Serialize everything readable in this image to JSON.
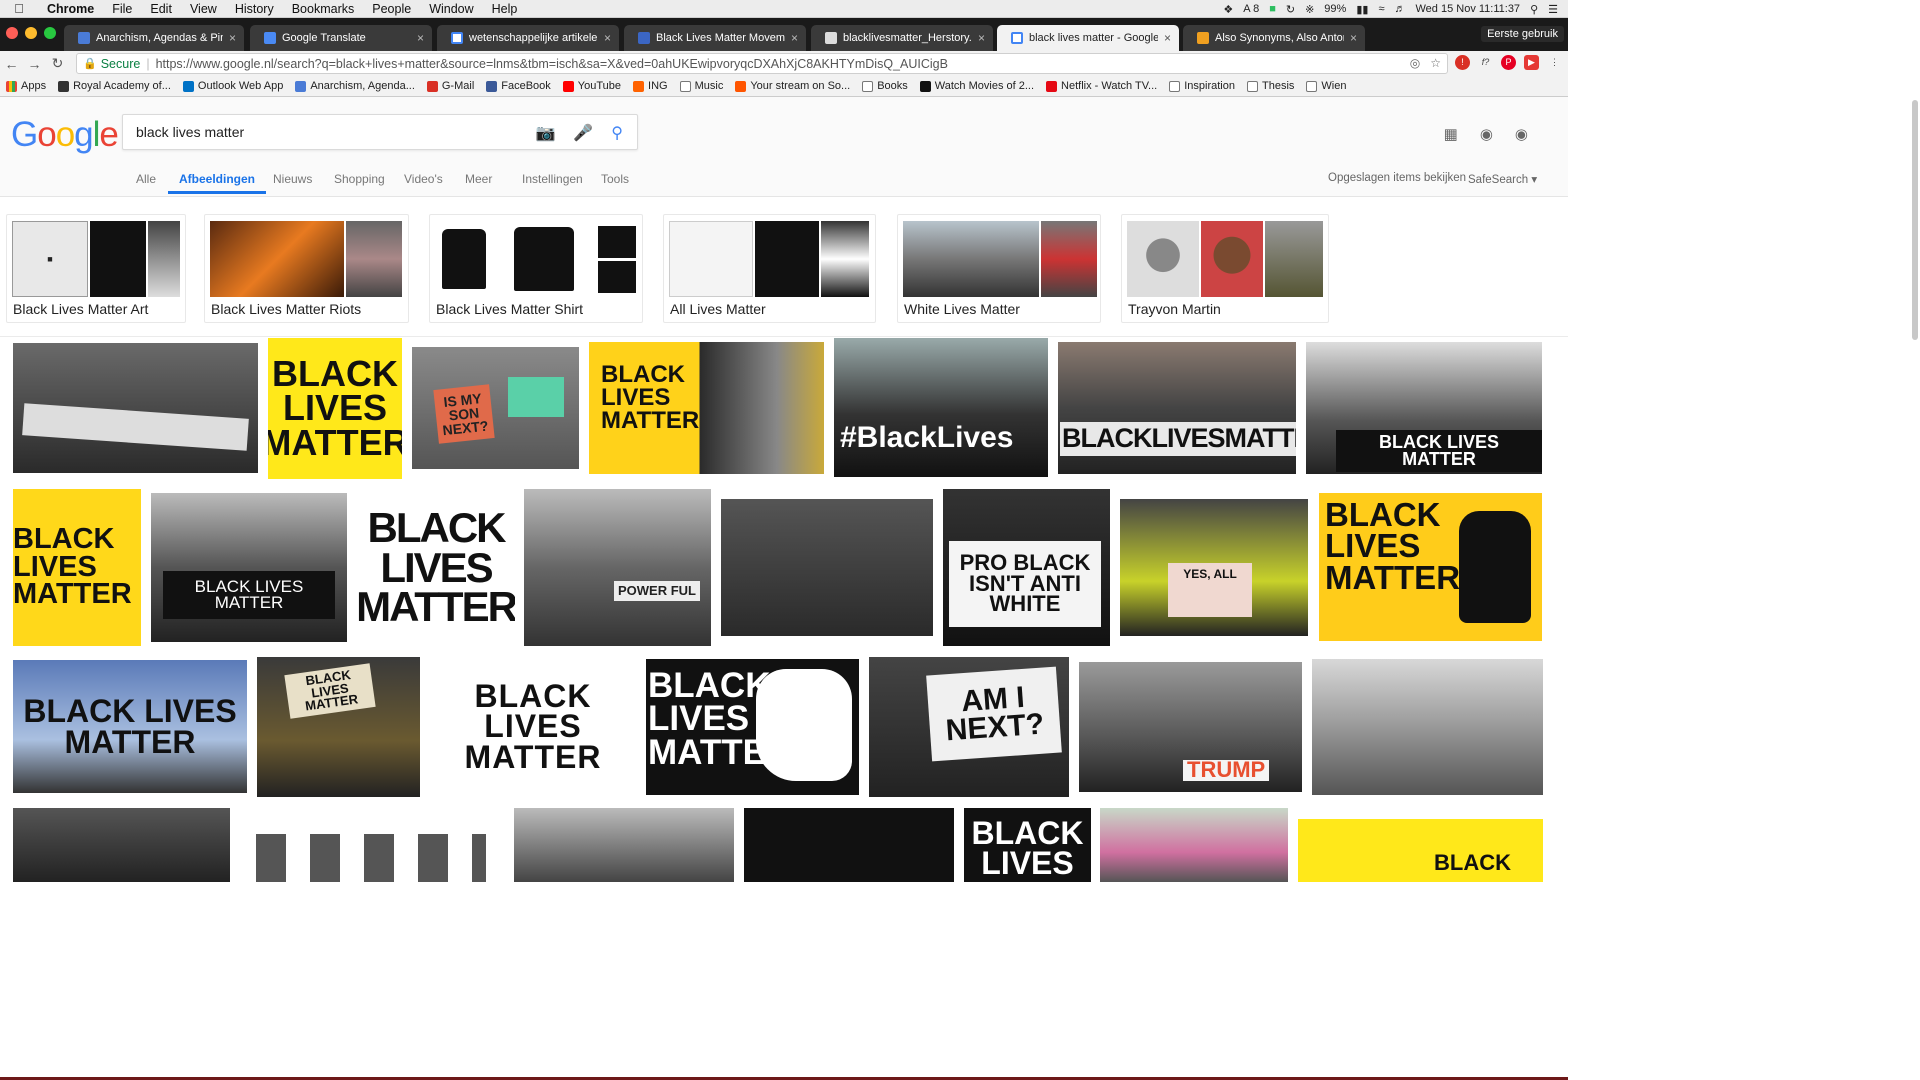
{
  "menubar": {
    "app": "Chrome",
    "items": [
      "File",
      "Edit",
      "View",
      "History",
      "Bookmarks",
      "People",
      "Window",
      "Help"
    ],
    "status": {
      "badge": "8",
      "battery": "99%",
      "clock": "Wed 15 Nov  11:11:37"
    }
  },
  "tabs": [
    {
      "label": "Anarchism, Agendas & Pin B",
      "color": "#4a7bd6",
      "active": false
    },
    {
      "label": "Google Translate",
      "color": "#4a8af4",
      "active": false
    },
    {
      "label": "wetenschappelijke artikelen",
      "color": "#ffffff",
      "active": false
    },
    {
      "label": "Black Lives Matter Movement",
      "color": "#3b66c4",
      "active": false
    },
    {
      "label": "blacklivesmatter_Herstory.pdf",
      "color": "#dddddd",
      "active": false
    },
    {
      "label": "black lives matter - Google zo",
      "color": "#ffffff",
      "active": true
    },
    {
      "label": "Also Synonyms, Also Antonym",
      "color": "#f0a020",
      "active": false
    }
  ],
  "profile": "Eerste gebruik",
  "address": {
    "secure": "Secure",
    "url": "https://www.google.nl/search?q=black+lives+matter&source=lnms&tbm=isch&sa=X&ved=0ahUKEwipvoryqcDXAhXjC8AKHTYmDisQ_AUICigB"
  },
  "bookmarks": [
    {
      "label": "Apps",
      "color": "#ea4335"
    },
    {
      "label": "Royal Academy of...",
      "color": "#333333"
    },
    {
      "label": "Outlook Web App",
      "color": "#0072c6"
    },
    {
      "label": "Anarchism, Agenda...",
      "color": "#4a7bd6"
    },
    {
      "label": "G-Mail",
      "color": "#d93025"
    },
    {
      "label": "FaceBook",
      "color": "#3b5998"
    },
    {
      "label": "YouTube",
      "color": "#ff0000"
    },
    {
      "label": "ING",
      "color": "#ff6200"
    },
    {
      "label": "Music",
      "color": "#888888"
    },
    {
      "label": "Your stream on So...",
      "color": "#ff5500"
    },
    {
      "label": "Books",
      "color": "#888888"
    },
    {
      "label": "Watch Movies of 2...",
      "color": "#111111"
    },
    {
      "label": "Netflix - Watch TV...",
      "color": "#e50914"
    },
    {
      "label": "Inspiration",
      "color": "#888888"
    },
    {
      "label": "Thesis",
      "color": "#888888"
    },
    {
      "label": "Wien",
      "color": "#888888"
    }
  ],
  "google": {
    "logo_letters": [
      {
        "ch": "G",
        "color": "#4285f4"
      },
      {
        "ch": "o",
        "color": "#ea4335"
      },
      {
        "ch": "o",
        "color": "#fbbc05"
      },
      {
        "ch": "g",
        "color": "#4285f4"
      },
      {
        "ch": "l",
        "color": "#34a853"
      },
      {
        "ch": "e",
        "color": "#ea4335"
      }
    ],
    "query": "black lives matter",
    "tabs": [
      "Alle",
      "Afbeeldingen",
      "Nieuws",
      "Shopping",
      "Video's",
      "Meer",
      "Instellingen",
      "Tools"
    ],
    "active_tab": "Afbeeldingen",
    "saved_items": "Opgeslagen items bekijken",
    "safesearch": "SafeSearch"
  },
  "related": [
    {
      "label": "Black Lives Matter Art"
    },
    {
      "label": "Black Lives Matter Riots"
    },
    {
      "label": "Black Lives Matter Shirt"
    },
    {
      "label": "All Lives Matter"
    },
    {
      "label": "White Lives Matter"
    },
    {
      "label": "Trayvon Martin"
    }
  ],
  "image_texts": {
    "r1_2": "BLACK LIVES MATTER",
    "r1_3": "IS MY SON NEXT?",
    "r1_4": "BLACK LIVES MATTER",
    "r1_5": "#BlackLives",
    "r1_6": "BLACKLIVESMATTER",
    "r1_7": "BLACK LIVES MATTER",
    "r2_1": "BLACK LIVES MATTER",
    "r2_2": "BLACK LIVES MATTER",
    "r2_3": "BLACK LIVES MATTER",
    "r2_4": "POWER FUL",
    "r2_6": "PRO BLACK ISN'T ANTI WHITE",
    "r2_7": "YES, ALL",
    "r2_8": "BLACK LIVES MATTER",
    "r3_1": "BLACK LIVES MATTER",
    "r3_2": "BLACK LIVES MATTER",
    "r3_3": "BLACK LIVES MATTER",
    "r3_4": "BLACK LIVES MATTER",
    "r3_5": "AM I NEXT?",
    "r3_6": "TRUMP",
    "r4_5": "BLACK LIVES",
    "r4_6": "BLACK"
  }
}
